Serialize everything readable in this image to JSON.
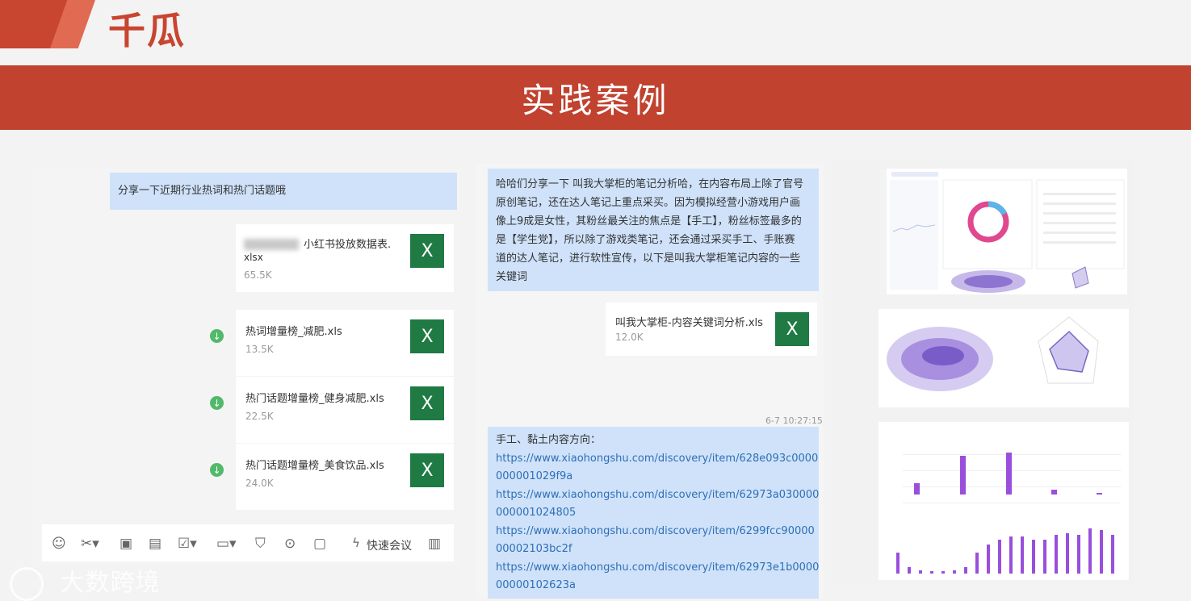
{
  "brand": {
    "name": "千瓜"
  },
  "banner": {
    "title": "实践案例"
  },
  "chat1": {
    "message": "分享一下近期行业热词和热门话题哦",
    "files": [
      {
        "name": "小红书投放数据表.",
        "ext": "xlsx",
        "size": "65.5K",
        "icon": "excel-icon"
      },
      {
        "name": "热词增量榜_减肥.xls",
        "size": "13.5K",
        "icon": "excel-icon"
      },
      {
        "name": "热门话题增量榜_健身减肥.xls",
        "size": "22.5K",
        "icon": "excel-icon"
      },
      {
        "name": "热门话题增量榜_美食饮品.xls",
        "size": "24.0K",
        "icon": "excel-icon"
      }
    ],
    "toolbar": {
      "meeting": "快速会议"
    }
  },
  "chat2": {
    "message_lines": [
      "哈哈们分享一下 叫我大掌柜的笔记分析哈，在内容布局上除了官号",
      "原创笔记，还在达人笔记上重点采买。因为模拟经营小游戏用户画",
      "像上9成是女性，其粉丝最关注的焦点是【手工】，粉丝标签最多的",
      "是【学生党】，所以除了游戏类笔记，还会通过采买手工、手账赛",
      "道的达人笔记，进行软性宣传，以下是叫我大掌柜笔记内容的一些",
      "关键词"
    ],
    "file": {
      "name": "叫我大掌柜-内容关键词分析.xls",
      "size": "12.0K"
    },
    "timestamp": "6-7 10:27:15",
    "links_heading": "手工、黏土内容方向：",
    "link_lines": [
      "https://www.xiaohongshu.com/discovery/item/628e093c0000",
      "000001029f9a",
      "https://www.xiaohongshu.com/discovery/item/62973a030000",
      "000001024805",
      "https://www.xiaohongshu.com/discovery/item/6299fcc90000",
      "00002103bc2f",
      "https://www.xiaohongshu.com/discovery/item/62973e1b0000",
      "00000102623a"
    ]
  },
  "watermark": {
    "text": "大数跨境"
  },
  "colors": {
    "brand_red": "#c0422f",
    "bubble_blue": "#cfe2fa",
    "excel_green": "#1f7a44",
    "link_blue": "#2f6fb5",
    "bar_purple": "#9a4fdc"
  }
}
